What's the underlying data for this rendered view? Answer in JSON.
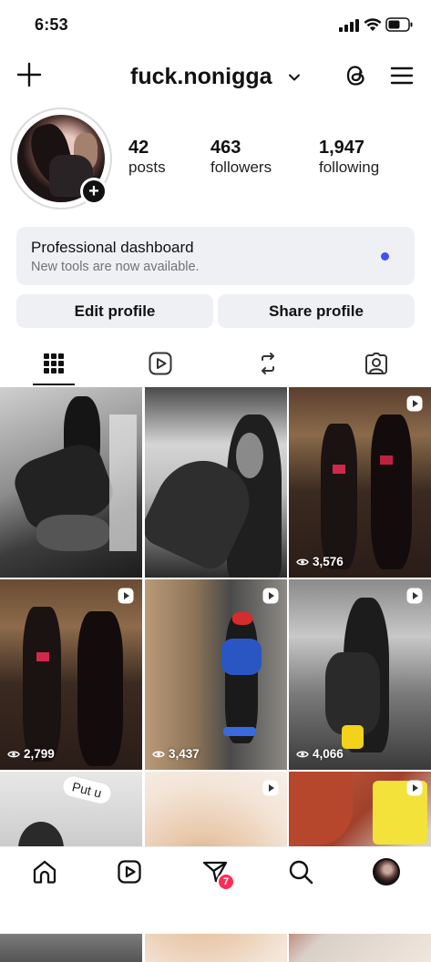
{
  "status_bar": {
    "time": "6:53"
  },
  "header": {
    "username": "fuck.nonigga"
  },
  "stats": [
    {
      "value": "42",
      "label": "posts"
    },
    {
      "value": "463",
      "label": "followers"
    },
    {
      "value": "1,947",
      "label": "following"
    }
  ],
  "dashboard": {
    "title": "Professional dashboard",
    "subtitle": "New tools are now available."
  },
  "buttons": {
    "edit": "Edit profile",
    "share": "Share profile"
  },
  "tabs": [
    "grid-icon",
    "reels-icon",
    "tagged-reposts-icon",
    "tagged-person-icon"
  ],
  "grid": [
    {
      "views": ""
    },
    {
      "views": ""
    },
    {
      "views": "3,576"
    },
    {
      "views": "2,799"
    },
    {
      "views": "3,437"
    },
    {
      "views": "4,066"
    },
    {
      "sticker": "Put u"
    },
    {
      "views": ""
    },
    {
      "views": ""
    }
  ],
  "nav": {
    "notifications": "7"
  },
  "colors": {
    "accent_dot": "#4150f7",
    "notif_badge": "#ff2d55"
  }
}
